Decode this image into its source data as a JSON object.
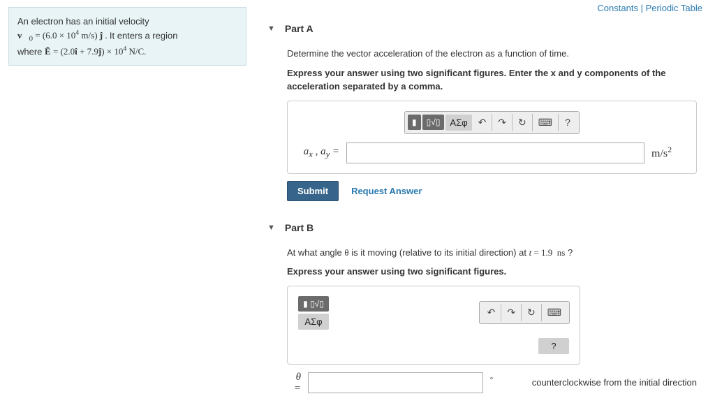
{
  "top_links": {
    "constants": "Constants",
    "sep": " | ",
    "periodic": "Periodic Table"
  },
  "problem": {
    "line1": "An electron has an initial velocity",
    "line2_html": "v⃗₀ = (6.0 × 10⁴ m/s) ĵ . It enters a region",
    "line3_html": "where Ê = (2.0î + 7.9ĵ) × 10⁴ N/C."
  },
  "partA": {
    "title": "Part A",
    "question": "Determine the vector acceleration of the electron as a function of time.",
    "instruction": "Express your answer using two significant figures. Enter the x and y components of the acceleration separated by a comma.",
    "var_label": "aₓ , a_y =",
    "unit": "m/s²",
    "submit": "Submit",
    "request": "Request Answer",
    "toolbar": {
      "templates": "▯√▯",
      "greek": "ΑΣφ",
      "undo": "↶",
      "redo": "↷",
      "reset": "↻",
      "keyboard": "⌨",
      "help": "?"
    }
  },
  "partB": {
    "title": "Part B",
    "question_pre": "At what angle ",
    "theta": "θ",
    "question_mid": " is it moving (relative to its initial direction) at ",
    "tval": "t = 1.9  ns",
    "question_post": " ?",
    "instruction": "Express your answer using two significant figures.",
    "var_label_top": "θ",
    "var_label_bot": "=",
    "degree": "°",
    "note": "counterclockwise from the initial direction",
    "toolbar": {
      "templates": "▯√▯",
      "greek": "ΑΣφ",
      "undo": "↶",
      "redo": "↷",
      "reset": "↻",
      "keyboard": "⌨",
      "help": "?"
    }
  }
}
